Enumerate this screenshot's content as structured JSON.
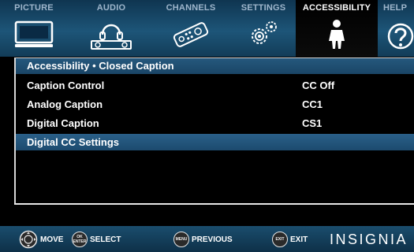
{
  "tabs": [
    {
      "label": "PICTURE",
      "icon": "tv-icon",
      "active": false
    },
    {
      "label": "AUDIO",
      "icon": "headphones-speaker-icon",
      "active": false
    },
    {
      "label": "CHANNELS",
      "icon": "remote-control-icon",
      "active": false
    },
    {
      "label": "SETTINGS",
      "icon": "gears-icon",
      "active": false
    },
    {
      "label": "ACCESSIBILITY",
      "icon": "person-icon",
      "active": true
    },
    {
      "label": "HELP",
      "icon": "question-mark-icon",
      "active": false
    }
  ],
  "menu": {
    "title": "Accessibility • Closed Caption",
    "items": [
      {
        "label": "Caption Control",
        "value": "CC Off",
        "selected": false
      },
      {
        "label": "Analog Caption",
        "value": "CC1",
        "selected": false
      },
      {
        "label": "Digital Caption",
        "value": "CS1",
        "selected": false
      },
      {
        "label": "Digital CC Settings",
        "value": "",
        "selected": true
      }
    ]
  },
  "hints": [
    {
      "button": "",
      "label": "MOVE",
      "icon": "dpad-icon"
    },
    {
      "button": "OK\nENTER",
      "label": "SELECT",
      "icon": "ok-enter-button-icon"
    },
    {
      "button": "MENU",
      "label": "PREVIOUS",
      "icon": "menu-button-icon"
    },
    {
      "button": "EXIT",
      "label": "EXIT",
      "icon": "exit-button-icon"
    }
  ],
  "brand": "INSIGNIA",
  "colors": {
    "tab_bar": "#1d5578",
    "highlight": "#2a6089",
    "text": "#ffffff",
    "inactive_tab_text": "#9fb6cc"
  }
}
